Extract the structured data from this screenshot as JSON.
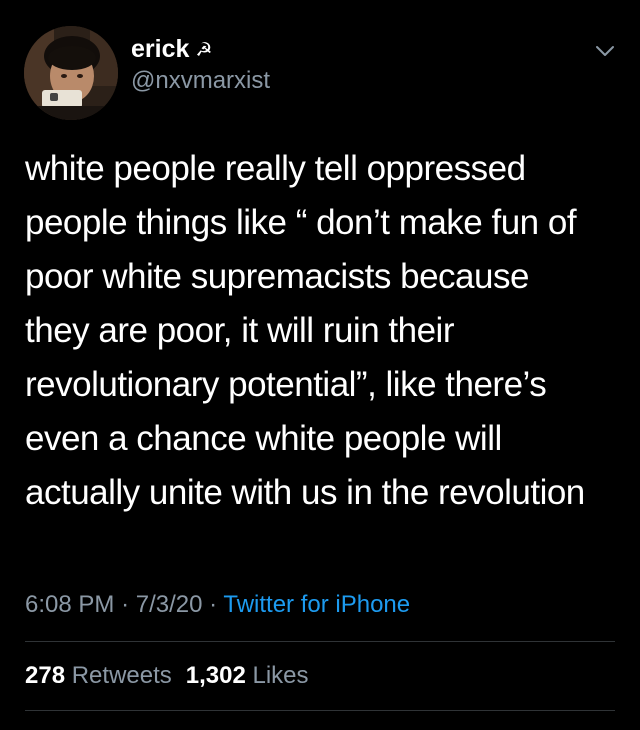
{
  "author": {
    "display_name": "erick",
    "name_emoji": "☭",
    "handle": "@nxvmarxist",
    "avatar_icon": "profile-photo",
    "menu_icon": "chevron-down-icon"
  },
  "tweet": {
    "text": "white people really tell oppressed\npeople things like  “ don’t make fun of\npoor white supremacists because\nthey are poor, it will ruin their\nrevolutionary potential”, like there’s\neven a chance white people will\nactually unite with us in the revolution",
    "time": "6:08 PM",
    "separator": "·",
    "date": "7/3/20",
    "source": "Twitter for iPhone"
  },
  "stats": {
    "retweets_count": "278",
    "retweets_label": "Retweets",
    "likes_count": "1,302",
    "likes_label": "Likes"
  },
  "colors": {
    "background": "#000000",
    "text_primary": "#ffffff",
    "text_secondary": "#8b98a5",
    "link": "#1d9bf0",
    "divider": "#2f3336"
  }
}
